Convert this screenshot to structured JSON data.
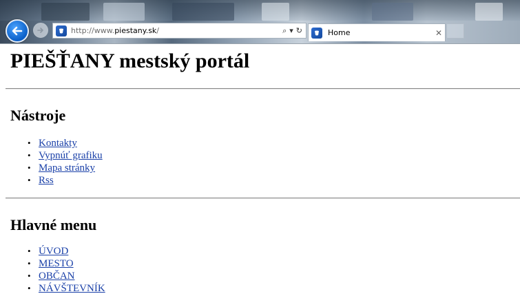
{
  "browser": {
    "url_prefix": "http://www.",
    "url_domain": "piestany.sk",
    "url_suffix": "/",
    "search_icon": "⌕",
    "dropdown_icon": "▾",
    "refresh_icon": "↻",
    "tab_title": "Home",
    "tab_close": "✕"
  },
  "page": {
    "title": "PIEŠŤANY mestský portál",
    "tools": {
      "heading": "Nástroje",
      "items": [
        "Kontakty",
        "Vypnúť grafiku",
        "Mapa stránky",
        "Rss"
      ]
    },
    "menu": {
      "heading": "Hlavné menu",
      "items": [
        "ÚVOD",
        "MESTO",
        "OBČAN",
        "NÁVŠTEVNÍK"
      ]
    }
  },
  "colors": {
    "link": "#1a40a8",
    "back_button": "#0b5fc7"
  }
}
